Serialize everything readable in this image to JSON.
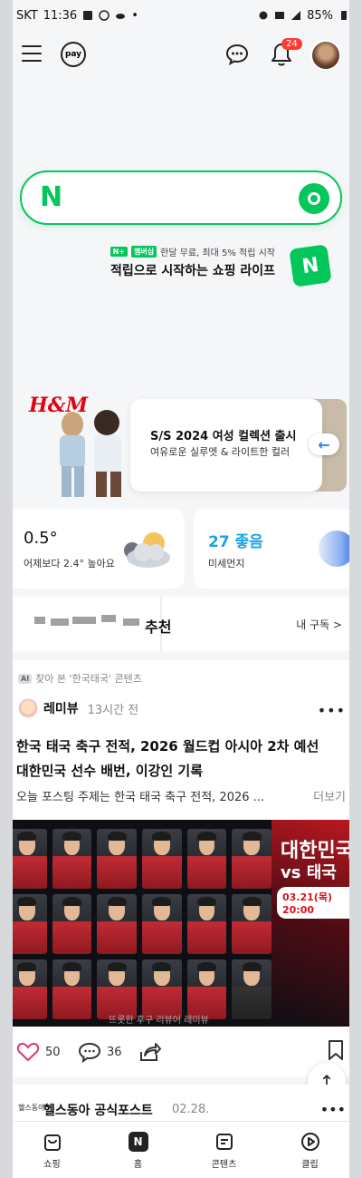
{
  "status": {
    "carrier": "SKT",
    "time": "11:36",
    "battery": "85%"
  },
  "topbar": {
    "pay_label": "pay",
    "notification_count": "24"
  },
  "search": {
    "logo": "N"
  },
  "promo": {
    "badge": "N+",
    "membership": "멤버십",
    "line1": "한달 무료, 최대 5% 적립 시작",
    "line2": "적립으로 시작하는 쇼핑 라이프"
  },
  "banner": {
    "brand": "H&M",
    "title": "S/S 2024 여성 컬렉션 출시",
    "subtitle": "여유로운 실루엣 & 라이트한 컬러"
  },
  "weather": {
    "temp": "0.5°",
    "compare": "어제보다 2.4° 높아요"
  },
  "dust": {
    "value": "27 좋음",
    "label": "미세먼지"
  },
  "subscribe": {
    "title": "추천",
    "link": "내 구독 >"
  },
  "feed": {
    "ai_badge": "AI",
    "ai_label": "찾아 본 '한국태국' 콘텐츠",
    "author": "레미뷰",
    "time": "13시간 전",
    "headline": "한국 태국 축구 전적, 2026 월드컵 아시아 2차 예선 대한민국 선수 배번, 이강인 기록",
    "snippet": "오늘 포스팅 주제는 한국 태국 축구 전적, 2026 ...",
    "more": "더보기",
    "image_title": "대한민국",
    "image_vs": "vs 태국",
    "image_date": "03.21(목) 20:00",
    "image_footer": "뜨롯한 후구 리뷰어 레미뷰",
    "likes": "50",
    "comments": "36"
  },
  "next_feed": {
    "logo": "헬스동아",
    "name": "헬스동아 공식포스트",
    "time": "02.28."
  },
  "bottomnav": {
    "items": [
      {
        "label": "쇼핑"
      },
      {
        "label": "홈"
      },
      {
        "label": "콘텐츠"
      },
      {
        "label": "클립"
      }
    ]
  }
}
